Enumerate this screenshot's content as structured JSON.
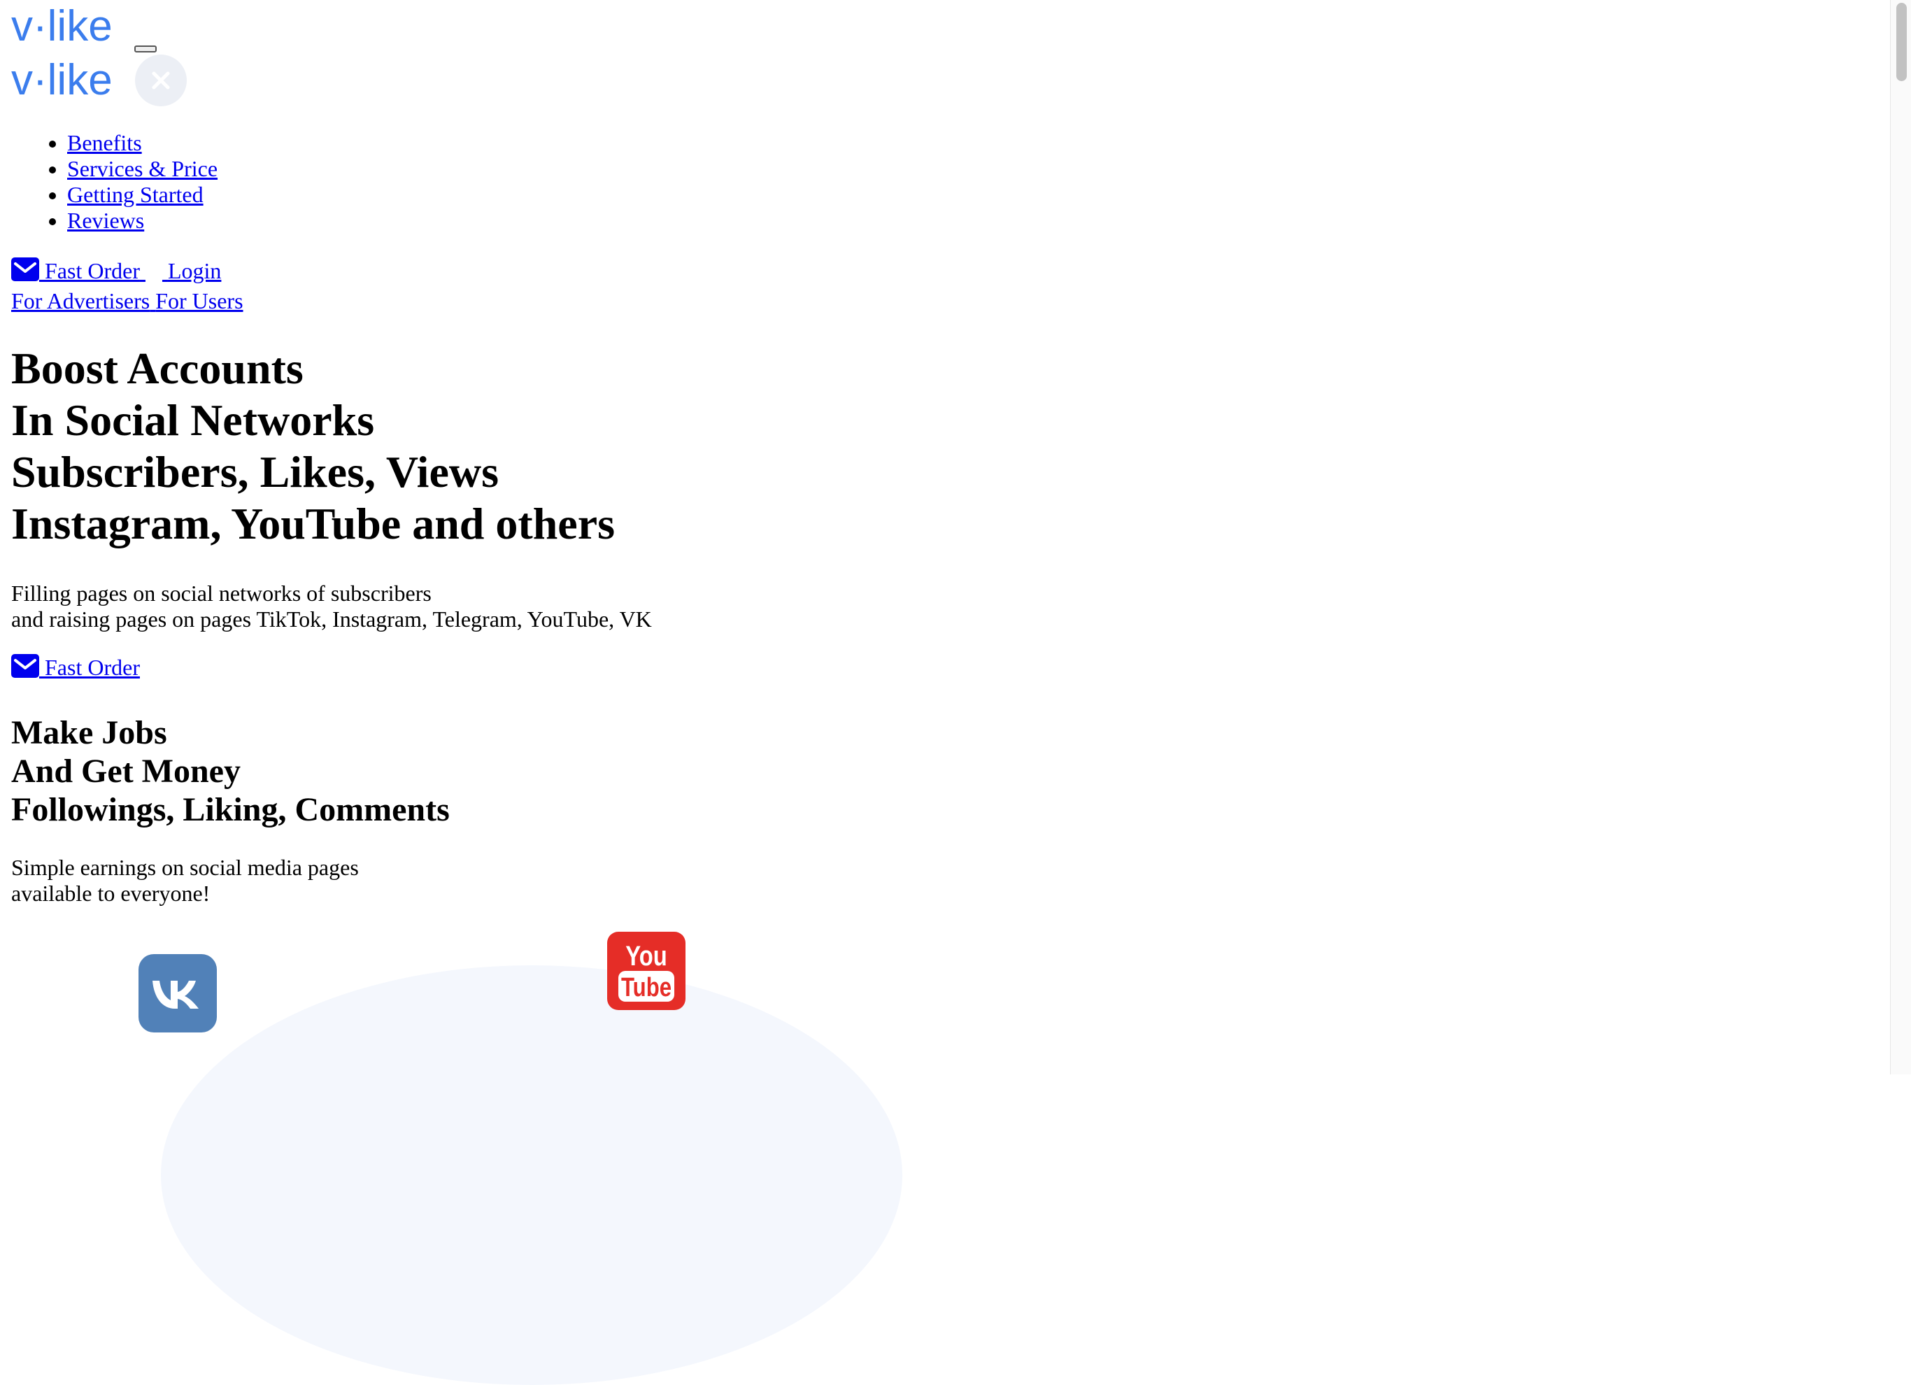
{
  "brand": {
    "logo_text": "v·like",
    "accent": "#3b7ded"
  },
  "nav": {
    "items": [
      {
        "label": "Benefits"
      },
      {
        "label": "Services & Price"
      },
      {
        "label": "Getting Started"
      },
      {
        "label": "Reviews"
      }
    ]
  },
  "header_actions": {
    "fast_order": "Fast Order",
    "login": "Login",
    "for_advertisers": "For Advertisers",
    "for_users": "For Users"
  },
  "hero": {
    "lines": [
      "Boost Accounts",
      "In Social Networks",
      "Subscribers, Likes, Views",
      "Instagram, YouTube and others"
    ],
    "description": [
      "Filling pages on social networks of subscribers",
      "and raising pages on pages TikTok, Instagram, Telegram, YouTube, VK"
    ],
    "cta": "Fast Order"
  },
  "earn": {
    "lines": [
      "Make Jobs",
      "And Get Money",
      "Followings, Liking, Comments"
    ],
    "description": [
      "Simple earnings on social media pages",
      "available to everyone!"
    ]
  },
  "social_icons": [
    {
      "name": "vk-icon",
      "label": "VK",
      "color": "#5181b8"
    },
    {
      "name": "youtube-icon",
      "label": "YouTube",
      "color": "#e52d27",
      "text_top": "You",
      "text_bottom": "Tube"
    }
  ]
}
